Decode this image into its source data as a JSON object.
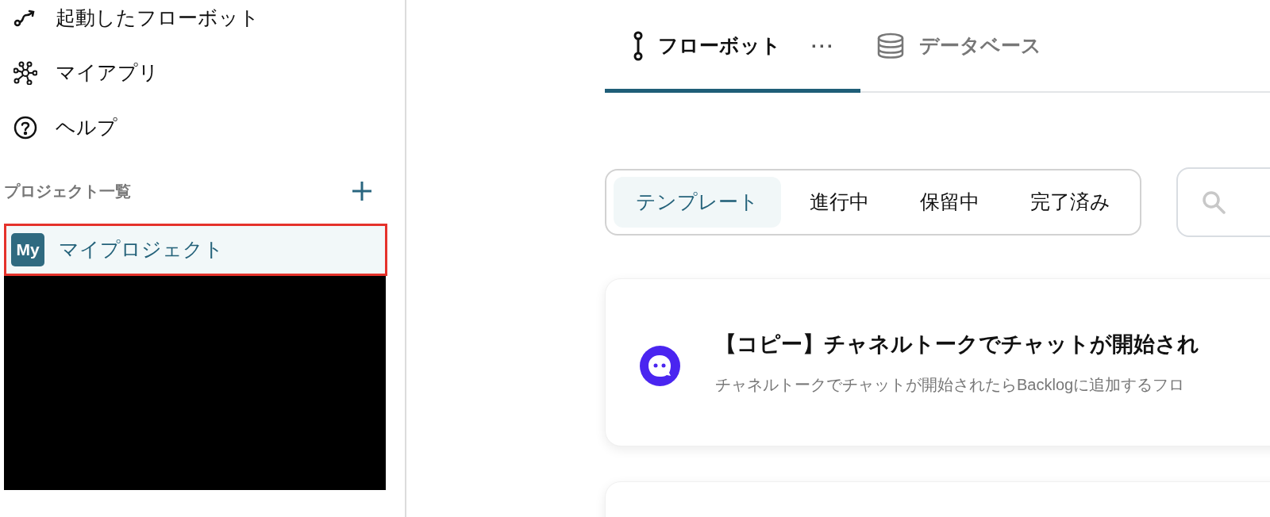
{
  "sidebar": {
    "nav_items": [
      {
        "label": "起動したフローボット",
        "kind": "flow"
      },
      {
        "label": "マイアプリ",
        "kind": "apps"
      },
      {
        "label": "ヘルプ",
        "kind": "help"
      }
    ],
    "projects_header": "プロジェクト一覧",
    "projects": [
      {
        "avatar": "My",
        "label": "マイプロジェクト",
        "selected": true,
        "highlighted": true
      }
    ]
  },
  "tabs": [
    {
      "label": "フローボット",
      "kind": "flow",
      "selected": true,
      "more": "···"
    },
    {
      "label": "データベース",
      "kind": "database",
      "selected": false
    }
  ],
  "filters": [
    {
      "label": "テンプレート",
      "selected": true
    },
    {
      "label": "進行中",
      "selected": false
    },
    {
      "label": "保留中",
      "selected": false
    },
    {
      "label": "完了済み",
      "selected": false
    }
  ],
  "cards": [
    {
      "title": "【コピー】チャネルトークでチャットが開始され",
      "description": "チャネルトークでチャットが開始されたらBacklogに追加するフロ"
    }
  ]
}
